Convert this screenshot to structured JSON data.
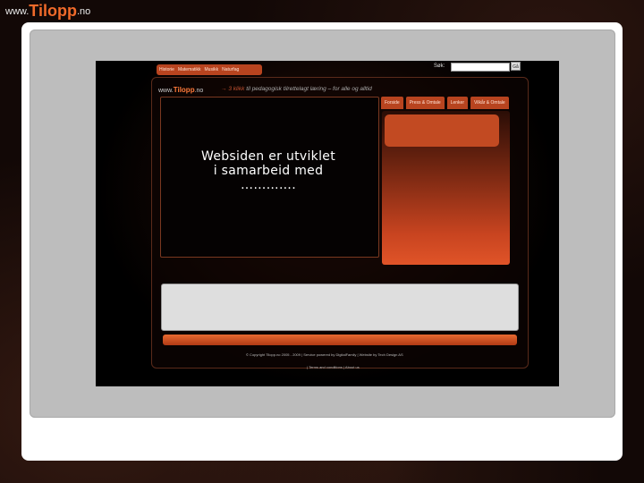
{
  "brand": {
    "prefix": "www.",
    "name": "Tilopp",
    "suffix": ".no"
  },
  "site": {
    "topnav": [
      "Historie",
      "Matematikk",
      "Musikk",
      "Naturfag"
    ],
    "search_label": "Søk:",
    "search_button": "Gå",
    "logo_prefix": "www.",
    "logo_name": "Tilopp",
    "logo_suffix": ".no",
    "tagline": "3 klikk",
    "tagline_rest": "til pedagogisk tilrettelagt læring – for alle og alltid",
    "tabs": [
      "Forside",
      "Press & Omtale",
      "Lenker",
      "Vilkår & Omtale"
    ],
    "footer_line1": "© Copyright Tilopp.no 2005 - 2009 | Service powered by DigitalFamily | Website by Tech Design AS",
    "footer_line2": "| Terms and conditions | About us"
  },
  "overlay": {
    "line1": "Websiden er utviklet",
    "line2": "i samarbeid med",
    "line3": "…………."
  }
}
